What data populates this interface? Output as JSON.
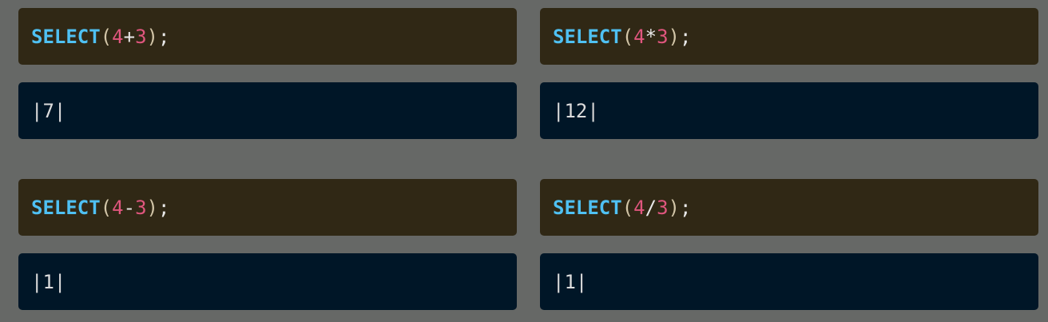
{
  "examples": [
    {
      "keyword": "SELECT",
      "open": "(",
      "left": "4",
      "operator": "+",
      "right": "3",
      "close": ")",
      "terminator": ";",
      "result": "|7|"
    },
    {
      "keyword": "SELECT",
      "open": "(",
      "left": "4",
      "operator": "*",
      "right": "3",
      "close": ")",
      "terminator": ";",
      "result": "|12|"
    },
    {
      "keyword": "SELECT",
      "open": "(",
      "left": "4",
      "operator": "-",
      "right": "3",
      "close": ")",
      "terminator": ";",
      "result": "|1|"
    },
    {
      "keyword": "SELECT",
      "open": "(",
      "left": "4",
      "operator": "/",
      "right": "3",
      "close": ")",
      "terminator": ";",
      "result": "|1|"
    }
  ],
  "colors": {
    "background": "#666866",
    "query_panel": "#302815",
    "result_panel": "#001627",
    "keyword": "#4fc1f3",
    "number": "#e0567e"
  }
}
